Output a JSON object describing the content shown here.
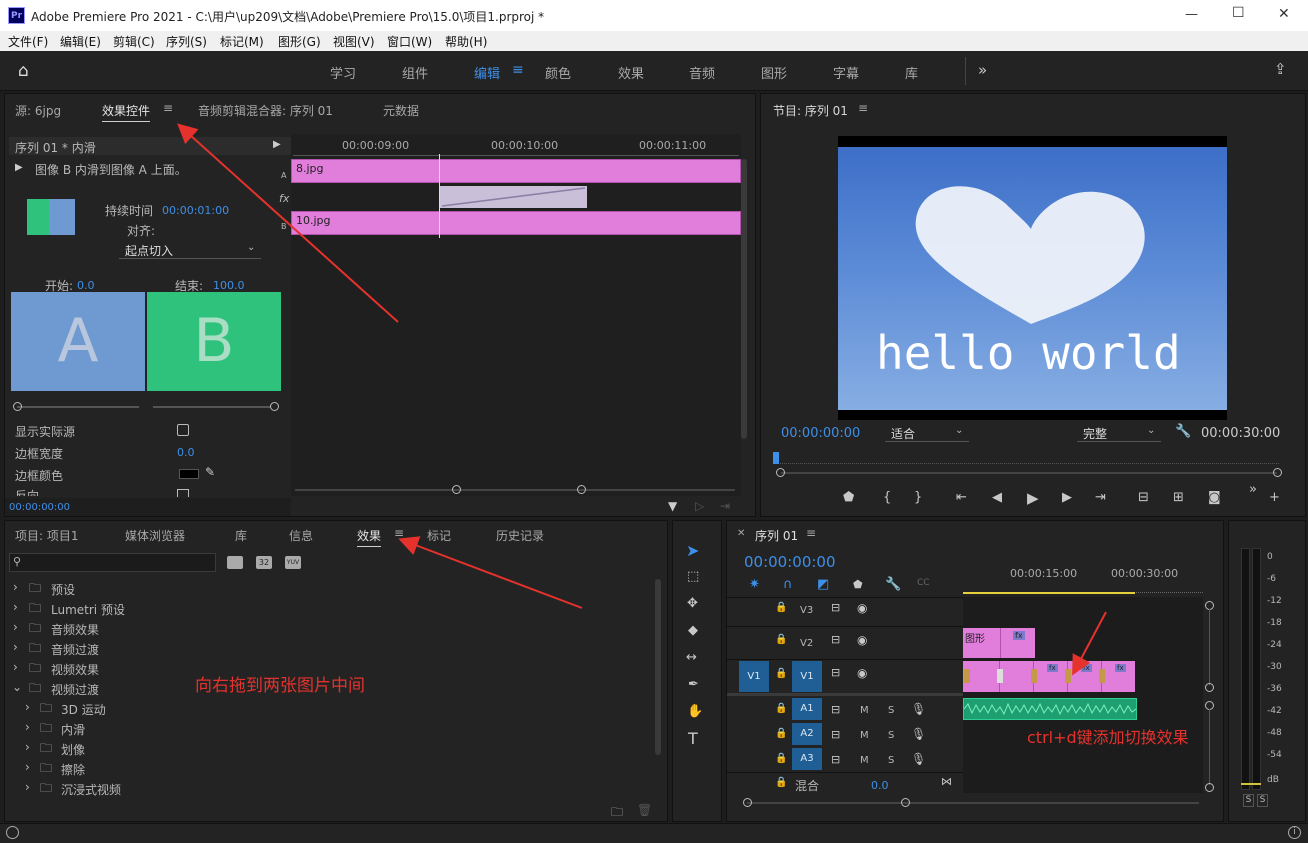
{
  "window": {
    "title": "Adobe Premiere Pro 2021 - C:\\用户\\up209\\文档\\Adobe\\Premiere Pro\\15.0\\项目1.prproj *",
    "app_icon": "Pr",
    "minimize": "—",
    "maximize": "☐",
    "close": "✕"
  },
  "menu": [
    "文件(F)",
    "编辑(E)",
    "剪辑(C)",
    "序列(S)",
    "标记(M)",
    "图形(G)",
    "视图(V)",
    "窗口(W)",
    "帮助(H)"
  ],
  "workspaces": [
    "学习",
    "组件",
    "编辑",
    "颜色",
    "效果",
    "音频",
    "图形",
    "字幕",
    "库"
  ],
  "top_left_panel": {
    "tabs": [
      "源: 6jpg",
      "效果控件",
      "音频剪辑混合器: 序列 01",
      "元数据"
    ],
    "seq_label": "序列 01 * 内滑",
    "desc": "图像 B 内滑到图像 A 上面。",
    "duration_label": "持续时间",
    "duration_value": "00:00:01:00",
    "align_label": "对齐:",
    "align_value": "起点切入",
    "start_label": "开始:",
    "start_value": "0.0",
    "end_label": "结束:",
    "end_value": "100.0",
    "thumb_a": "A",
    "thumb_b": "B",
    "show_source": "显示实际源",
    "border_width_label": "边框宽度",
    "border_width_value": "0.0",
    "border_color_label": "边框颜色",
    "reverse_label": "反向",
    "timecode": "00:00:00:00",
    "ruler": [
      "00:00:09:00",
      "00:00:10:00",
      "00:00:11:00"
    ],
    "clip_a": "8.jpg",
    "clip_b": "10.jpg",
    "track_a": "A",
    "track_b": "B",
    "fx": "fx"
  },
  "program": {
    "title": "节目: 序列 01",
    "video_text": "hello world",
    "timecode": "00:00:00:00",
    "fit": "适合",
    "quality": "完整",
    "duration": "00:00:30:00"
  },
  "project_panel": {
    "tabs": [
      "项目: 项目1",
      "媒体浏览器",
      "库",
      "信息",
      "效果",
      "标记",
      "历史记录"
    ],
    "items": [
      "预设",
      "Lumetri 预设",
      "音频效果",
      "音频过渡",
      "视频效果",
      "视频过渡"
    ],
    "subitems": [
      "3D 运动",
      "内滑",
      "划像",
      "擦除",
      "沉浸式视频"
    ],
    "icons_32": "32",
    "icons_yuv": "YUV"
  },
  "timeline": {
    "title": "序列 01",
    "timecode": "00:00:00:00",
    "ruler": [
      "00:00:15:00",
      "00:00:30:00"
    ],
    "tracks_v": [
      "V3",
      "V2",
      "V1"
    ],
    "tracks_a": [
      "A1",
      "A2",
      "A3"
    ],
    "v1_src": "V1",
    "mix_label": "混合",
    "mix_value": "0.0",
    "graphic_clip": "图形",
    "m": "M",
    "s": "S"
  },
  "meter": {
    "labels": [
      "0",
      "-6",
      "-12",
      "-18",
      "-24",
      "-30",
      "-36",
      "-42",
      "-48",
      "-54",
      "dB"
    ],
    "s1": "S",
    "s2": "S"
  },
  "annotations": {
    "drag_note": "向右拖到两张图片中间",
    "shortcut_note": "ctrl+d键添加切换效果"
  }
}
